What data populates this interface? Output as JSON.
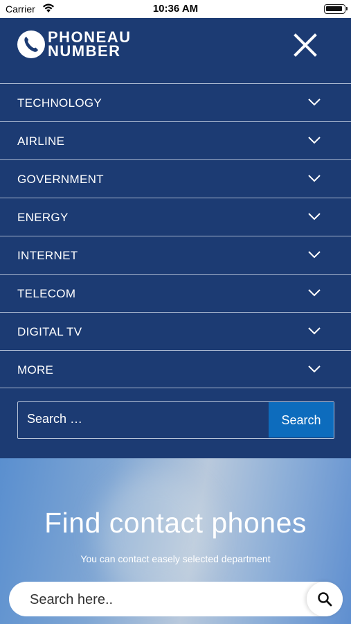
{
  "status_bar": {
    "carrier": "Carrier",
    "time": "10:36 AM"
  },
  "header": {
    "brand_line1": "PHONEAU",
    "brand_line2": "NUMBER",
    "logo_icon": "phone-icon",
    "close_icon": "close-icon"
  },
  "menu": {
    "items": [
      {
        "label": "TECHNOLOGY"
      },
      {
        "label": "AIRLINE"
      },
      {
        "label": "GOVERNMENT"
      },
      {
        "label": "ENERGY"
      },
      {
        "label": "INTERNET"
      },
      {
        "label": "TELECOM"
      },
      {
        "label": "DIGITAL TV"
      },
      {
        "label": "MORE"
      }
    ],
    "expand_icon": "chevron-down-icon"
  },
  "search": {
    "placeholder": "Search …",
    "button_label": "Search"
  },
  "hero": {
    "title": "Find contact phones",
    "subtitle": "You can contact easely selected department",
    "search_placeholder": "Search here..",
    "search_icon": "search-icon"
  },
  "colors": {
    "primary": "#1c3b73",
    "button": "#0d6cbd",
    "divider": "#a8b6cf",
    "text": "#ffffff"
  }
}
